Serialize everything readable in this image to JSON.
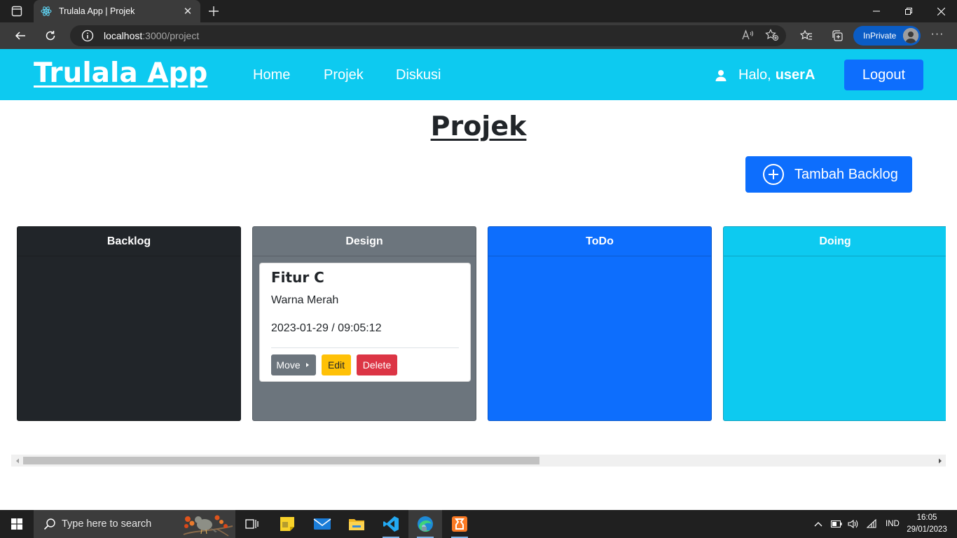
{
  "browser": {
    "tab_title": "Trulala App | Projek",
    "url_host": "localhost",
    "url_path": ":3000/project",
    "inprivate_label": "InPrivate"
  },
  "navbar": {
    "brand": "Trulala App",
    "links": [
      "Home",
      "Projek",
      "Diskusi"
    ],
    "greeting": "Halo,",
    "username": "userA",
    "logout_label": "Logout",
    "bg_color": "#0dcaf0"
  },
  "page": {
    "title": "Projek",
    "add_button_label": "Tambah Backlog"
  },
  "board": {
    "columns": [
      {
        "title": "Backlog",
        "color": "#212529"
      },
      {
        "title": "Design",
        "color": "#6c757d"
      },
      {
        "title": "ToDo",
        "color": "#0d6efd"
      },
      {
        "title": "Doing",
        "color": "#0dcaf0"
      }
    ],
    "cards": [
      {
        "column": "Design",
        "title": "Fitur C",
        "description": "Warna Merah",
        "datetime": "2023-01-29 / 09:05:12",
        "buttons": {
          "move": "Move",
          "edit": "Edit",
          "delete": "Delete"
        }
      }
    ]
  },
  "taskbar": {
    "search_placeholder": "Type here to search",
    "language": "IND",
    "time": "16:05",
    "date": "29/01/2023"
  }
}
